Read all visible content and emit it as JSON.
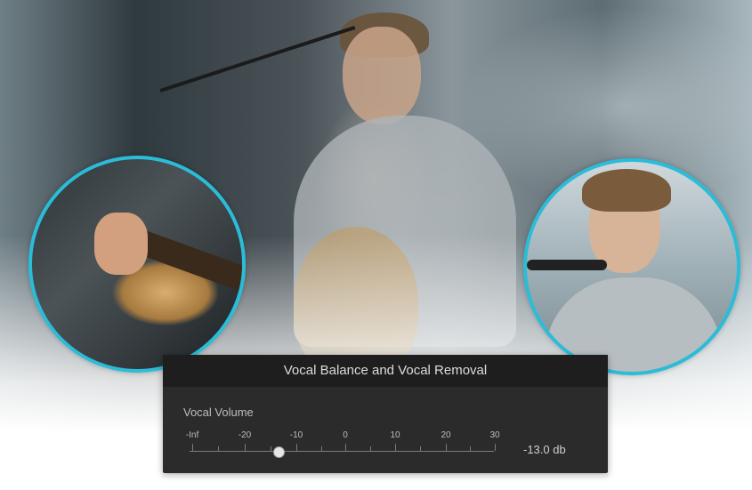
{
  "panel": {
    "title": "Vocal Balance and Vocal Removal",
    "vocal_volume_label": "Vocal Volume",
    "scale_labels": [
      "-Inf",
      "-20",
      "-10",
      "0",
      "10",
      "20",
      "30"
    ],
    "slider_value": -13.0,
    "readout": "-13.0 db"
  },
  "colors": {
    "accent_ring": "#2bbcd8",
    "panel_bg": "#2b2b2b",
    "panel_header_bg": "#1e1e1e"
  },
  "icons": {
    "slider_knob": "slider-knob-icon"
  }
}
